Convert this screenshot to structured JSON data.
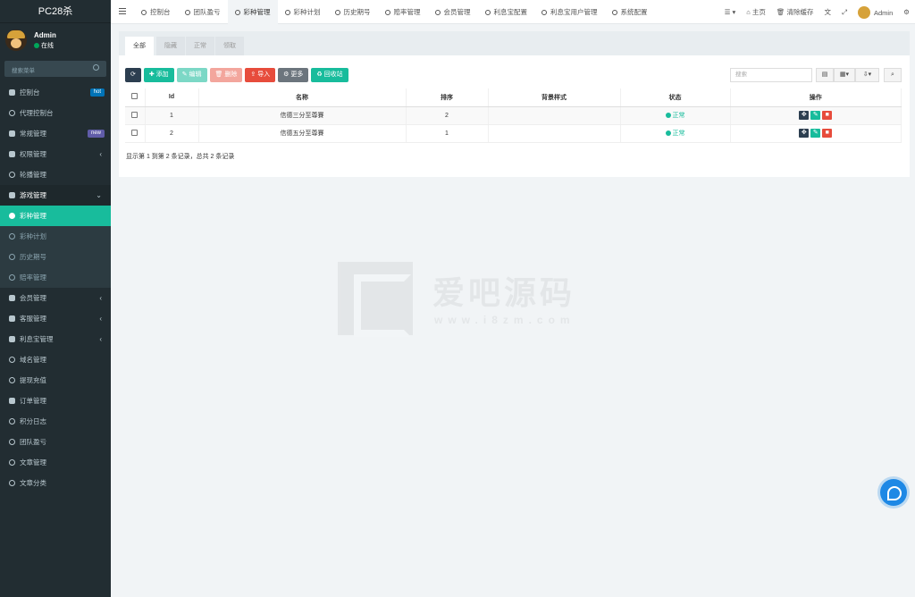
{
  "sidebar": {
    "logo": "PC28杀",
    "user": {
      "name": "Admin",
      "status": "在线"
    },
    "search_placeholder": "搜索菜单",
    "items": [
      {
        "label": "控制台",
        "badge": "hot",
        "badge_color": "#0073b7"
      },
      {
        "label": "代理控制台"
      },
      {
        "label": "常规管理",
        "badge": "new",
        "badge_color": "#605ca8"
      },
      {
        "label": "权限管理",
        "caret": "‹"
      },
      {
        "label": "轮播管理"
      },
      {
        "label": "游戏管理",
        "caret": "⌄"
      },
      {
        "label": "彩种管理"
      },
      {
        "label": "彩种计划"
      },
      {
        "label": "历史期号"
      },
      {
        "label": "赔率管理"
      },
      {
        "label": "会员管理",
        "caret": "‹"
      },
      {
        "label": "客服管理",
        "caret": "‹"
      },
      {
        "label": "利息宝管理",
        "caret": "‹"
      },
      {
        "label": "域名管理"
      },
      {
        "label": "提现充值"
      },
      {
        "label": "订单管理"
      },
      {
        "label": "积分日志"
      },
      {
        "label": "团队盈亏"
      },
      {
        "label": "文章管理"
      },
      {
        "label": "文章分类"
      }
    ]
  },
  "header": {
    "tabs": [
      "控制台",
      "团队盈亏",
      "彩种管理",
      "彩种计划",
      "历史期号",
      "赔率管理",
      "会员管理",
      "利息宝配置",
      "利息宝用户管理",
      "系统配置"
    ],
    "right": {
      "home": "主页",
      "clear_cache": "清除缓存",
      "admin": "Admin"
    }
  },
  "panel": {
    "tabs": [
      "全部",
      "隐藏",
      "正常",
      "领取"
    ],
    "toolbar": {
      "refresh": "⟳",
      "add": "添加",
      "edit": "编辑",
      "delete": "删除",
      "import": "导入",
      "more": "更多",
      "recycle": "回收站"
    },
    "search_placeholder": "搜索",
    "columns": [
      "Id",
      "名称",
      "排序",
      "背景样式",
      "状态",
      "操作"
    ],
    "rows": [
      {
        "id": "1",
        "name": "信德三分至尊賽",
        "sort": "2",
        "bg": "",
        "status": "正常"
      },
      {
        "id": "2",
        "name": "信德五分至尊賽",
        "sort": "1",
        "bg": "",
        "status": "正常"
      }
    ],
    "summary": "显示第 1 到第 2 条记录，总共 2 条记录"
  },
  "watermark": {
    "title": "爱吧源码",
    "url": "www.i8zm.com"
  },
  "colors": {
    "sidebar": "#222d32",
    "accent": "#18bc9c",
    "danger": "#e74c3c",
    "dark": "#2c3e50"
  }
}
